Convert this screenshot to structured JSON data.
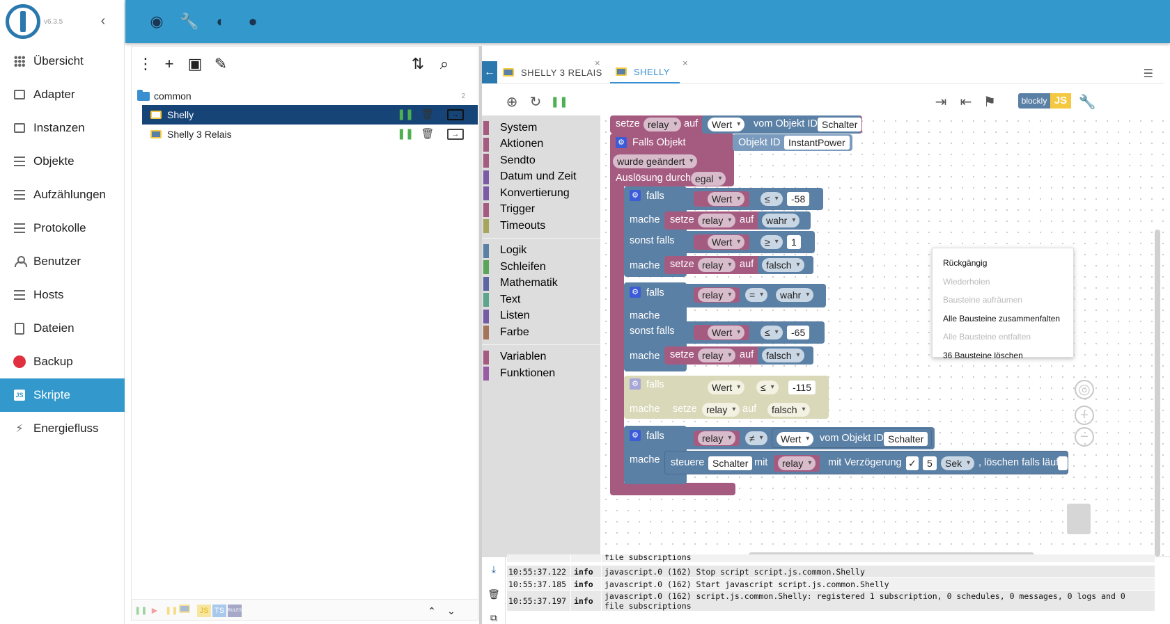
{
  "app": {
    "version": "v6.3.5"
  },
  "sidebar": {
    "items": [
      {
        "label": "Übersicht",
        "icon": "grid-icon"
      },
      {
        "label": "Adapter",
        "icon": "store-icon"
      },
      {
        "label": "Instanzen",
        "icon": "instances-icon"
      },
      {
        "label": "Objekte",
        "icon": "list-icon"
      },
      {
        "label": "Aufzählungen",
        "icon": "enum-icon"
      },
      {
        "label": "Protokolle",
        "icon": "log-icon"
      },
      {
        "label": "Benutzer",
        "icon": "user-icon"
      },
      {
        "label": "Hosts",
        "icon": "hosts-icon"
      },
      {
        "label": "Dateien",
        "icon": "files-icon"
      },
      {
        "label": "Backup",
        "icon": "backup-icon"
      },
      {
        "label": "Skripte",
        "icon": "js-icon"
      },
      {
        "label": "Energiefluss",
        "icon": "energy-icon"
      }
    ],
    "active": "Skripte"
  },
  "tree": {
    "folder": {
      "name": "common",
      "count": "2"
    },
    "items": [
      {
        "name": "Shelly",
        "selected": true
      },
      {
        "name": "Shelly 3 Relais",
        "selected": false
      }
    ],
    "footer": {
      "js": "JS",
      "ts": "TS",
      "rules": "RULES"
    }
  },
  "tabs": [
    {
      "label": "SHELLY 3 RELAIS",
      "active": false
    },
    {
      "label": "SHELLY",
      "active": true
    }
  ],
  "mode": {
    "blockly": "blockly",
    "js": "JS"
  },
  "toolbox": {
    "groups": [
      [
        {
          "label": "System",
          "color": "#a55b80"
        },
        {
          "label": "Aktionen",
          "color": "#a55b80"
        },
        {
          "label": "Sendto",
          "color": "#a55b80"
        },
        {
          "label": "Datum und Zeit",
          "color": "#7b5ba5"
        },
        {
          "label": "Konvertierung",
          "color": "#7b5ba5"
        },
        {
          "label": "Trigger",
          "color": "#a55b80"
        },
        {
          "label": "Timeouts",
          "color": "#a5a55b"
        }
      ],
      [
        {
          "label": "Logik",
          "color": "#5b80a5"
        },
        {
          "label": "Schleifen",
          "color": "#5ba55b"
        },
        {
          "label": "Mathematik",
          "color": "#5b67a5"
        },
        {
          "label": "Text",
          "color": "#5ba58c"
        },
        {
          "label": "Listen",
          "color": "#745ba5"
        },
        {
          "label": "Farbe",
          "color": "#a5745b"
        }
      ],
      [
        {
          "label": "Variablen",
          "color": "#a55b80"
        },
        {
          "label": "Funktionen",
          "color": "#995ba5"
        }
      ]
    ]
  },
  "blocks": {
    "setze_top": {
      "setze": "setze",
      "var": "relay",
      "auf": "auf",
      "wert": "Wert",
      "vom": "vom Objekt ID",
      "obj": "Schalter"
    },
    "trigger": {
      "falls_objekt": "Falls Objekt",
      "objekt_id": "Objekt ID",
      "obj": "InstantPower",
      "wurde": "wurde geändert",
      "ausloesung": "Auslösung durch",
      "egal": "egal"
    },
    "if1": {
      "falls": "falls",
      "wert": "Wert",
      "op": "≤",
      "num": "-58",
      "mache": "mache",
      "setze": "setze",
      "var": "relay",
      "auf": "auf",
      "val": "wahr",
      "sonst": "sonst falls",
      "wert2": "Wert",
      "op2": "≥",
      "num2": "1",
      "mache2": "mache",
      "setze2": "setze",
      "var2": "relay",
      "auf2": "auf",
      "val2": "falsch"
    },
    "if2": {
      "falls": "falls",
      "var": "relay",
      "op": "=",
      "val": "wahr",
      "mache": "mache",
      "sonst": "sonst falls",
      "wert": "Wert",
      "op2": "≤",
      "num": "-65",
      "mache2": "mache",
      "setze": "setze",
      "var2": "relay",
      "auf": "auf",
      "val2": "falsch"
    },
    "if3": {
      "falls": "falls",
      "wert": "Wert",
      "op": "≤",
      "num": "-115",
      "mache": "mache",
      "setze": "setze",
      "var": "relay",
      "auf": "auf",
      "val": "falsch"
    },
    "if4": {
      "falls": "falls",
      "var": "relay",
      "op": "≠",
      "wert": "Wert",
      "vom": "vom Objekt ID",
      "obj": "Schalter",
      "mache": "mache",
      "steuere": "steuere",
      "obj2": "Schalter",
      "mit": "mit",
      "var2": "relay",
      "verz": "mit Verzögerung",
      "check": "✓",
      "num": "5",
      "unit": "Sek",
      "loeschen": ", löschen falls läuft"
    }
  },
  "context_menu": [
    {
      "label": "Rückgängig",
      "enabled": true
    },
    {
      "label": "Wiederholen",
      "enabled": false
    },
    {
      "label": "Bausteine aufräumen",
      "enabled": false
    },
    {
      "label": "Alle Bausteine zusammenfalten",
      "enabled": true
    },
    {
      "label": "Alle Bausteine entfalten",
      "enabled": false
    },
    {
      "label": "36 Bausteine löschen",
      "enabled": true
    }
  ],
  "log": {
    "partial": "file subscriptions",
    "rows": [
      {
        "time": "10:55:37.122",
        "sev": "info",
        "msg": "javascript.0 (162) Stop script script.js.common.Shelly"
      },
      {
        "time": "10:55:37.185",
        "sev": "info",
        "msg": "javascript.0 (162) Start javascript script.js.common.Shelly"
      },
      {
        "time": "10:55:37.197",
        "sev": "info",
        "msg": "javascript.0 (162) script.js.common.Shelly: registered 1 subscription, 0 schedules, 0 messages, 0 logs and 0\nfile subscriptions"
      }
    ]
  }
}
